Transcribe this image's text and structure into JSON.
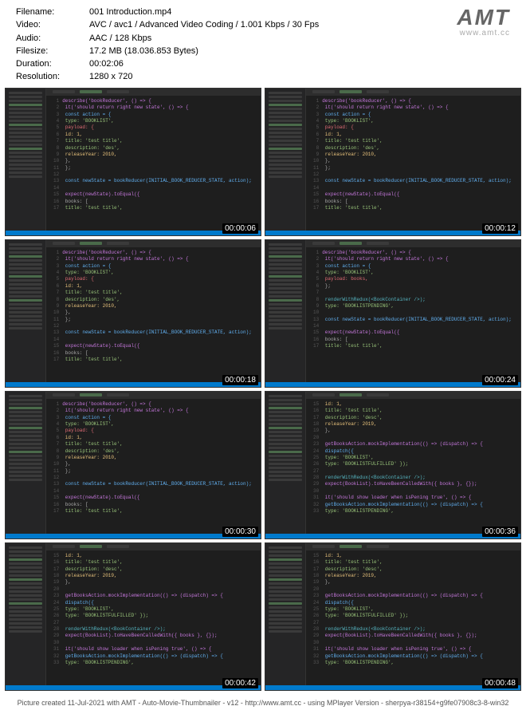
{
  "meta": {
    "labels": {
      "filename": "Filename:",
      "video": "Video:",
      "audio": "Audio:",
      "filesize": "Filesize:",
      "duration": "Duration:",
      "resolution": "Resolution:"
    },
    "values": {
      "filename": "001 Introduction.mp4",
      "video": "AVC / avc1 / Advanced Video Coding / 1.001 Kbps / 30 Fps",
      "audio": "AAC / 128 Kbps",
      "filesize": "17.2 MB (18.036.853 Bytes)",
      "duration": "00:02:06",
      "resolution": "1280 x 720"
    }
  },
  "logo": {
    "big": "AMT",
    "small": "www.amt.cc"
  },
  "thumbnails": [
    {
      "timestamp": "00:00:06",
      "variant": "a"
    },
    {
      "timestamp": "00:00:12",
      "variant": "a"
    },
    {
      "timestamp": "00:00:18",
      "variant": "a"
    },
    {
      "timestamp": "00:00:24",
      "variant": "b"
    },
    {
      "timestamp": "00:00:30",
      "variant": "a"
    },
    {
      "timestamp": "00:00:36",
      "variant": "c"
    },
    {
      "timestamp": "00:00:42",
      "variant": "c"
    },
    {
      "timestamp": "00:00:48",
      "variant": "c"
    }
  ],
  "code_variant_a": [
    {
      "n": "1",
      "t": "describe('bookReducer', () => {",
      "c": "pur"
    },
    {
      "n": "2",
      "t": "  it('should return right new state', () => {",
      "c": "pur"
    },
    {
      "n": "3",
      "t": "    const action = {",
      "c": "blu"
    },
    {
      "n": "4",
      "t": "      type: 'BOOKLIST',",
      "c": "grn"
    },
    {
      "n": "5",
      "t": "      payload: {",
      "c": "red"
    },
    {
      "n": "6",
      "t": "        id: 1,",
      "c": "yel"
    },
    {
      "n": "7",
      "t": "        title: 'test title',",
      "c": "grn"
    },
    {
      "n": "8",
      "t": "        description: 'des',",
      "c": "grn"
    },
    {
      "n": "9",
      "t": "        releaseYear: 2010,",
      "c": "yel"
    },
    {
      "n": "10",
      "t": "      },",
      "c": ""
    },
    {
      "n": "11",
      "t": "    };",
      "c": ""
    },
    {
      "n": "12",
      "t": "",
      "c": ""
    },
    {
      "n": "13",
      "t": "    const newState = bookReducer(INITIAL_BOOK_REDUCER_STATE, action);",
      "c": "blu"
    },
    {
      "n": "14",
      "t": "",
      "c": ""
    },
    {
      "n": "15",
      "t": "    expect(newState).toEqual({",
      "c": "pur"
    },
    {
      "n": "16",
      "t": "      books: [",
      "c": ""
    },
    {
      "n": "17",
      "t": "        title: 'test title',",
      "c": "grn"
    }
  ],
  "code_variant_b": [
    {
      "n": "1",
      "t": "describe('bookReducer', () => {",
      "c": "pur"
    },
    {
      "n": "2",
      "t": "  it('should return right new state', () => {",
      "c": "pur"
    },
    {
      "n": "3",
      "t": "    const action = {",
      "c": "blu"
    },
    {
      "n": "4",
      "t": "      type: 'BOOKLIST',",
      "c": "grn"
    },
    {
      "n": "5",
      "t": "      payload: books,",
      "c": "red"
    },
    {
      "n": "6",
      "t": "    };",
      "c": ""
    },
    {
      "n": "7",
      "t": "",
      "c": ""
    },
    {
      "n": "8",
      "t": "    renderWithRedux(<BookContainer />);",
      "c": "cyn"
    },
    {
      "n": "9",
      "t": "      type: 'BOOKLISTPENDING',",
      "c": "grn"
    },
    {
      "n": "10",
      "t": "",
      "c": ""
    },
    {
      "n": "13",
      "t": "    const newState = bookReducer(INITIAL_BOOK_REDUCER_STATE, action);",
      "c": "blu"
    },
    {
      "n": "14",
      "t": "",
      "c": ""
    },
    {
      "n": "15",
      "t": "    expect(newState).toEqual({",
      "c": "pur"
    },
    {
      "n": "16",
      "t": "      books: [",
      "c": ""
    },
    {
      "n": "17",
      "t": "        title: 'test title',",
      "c": "grn"
    }
  ],
  "code_variant_c": [
    {
      "n": "15",
      "t": "      id: 1,",
      "c": "yel"
    },
    {
      "n": "16",
      "t": "      title: 'test title',",
      "c": "grn"
    },
    {
      "n": "17",
      "t": "      description: 'desc',",
      "c": "grn"
    },
    {
      "n": "18",
      "t": "      releaseYear: 2019,",
      "c": "yel"
    },
    {
      "n": "19",
      "t": "    },",
      "c": ""
    },
    {
      "n": "20",
      "t": "",
      "c": ""
    },
    {
      "n": "23",
      "t": "  getBooksAction.mockImplementation(() => (dispatch) => {",
      "c": "pur"
    },
    {
      "n": "24",
      "t": "    dispatch({",
      "c": "blu"
    },
    {
      "n": "25",
      "t": "      type: 'BOOKLIST',",
      "c": "grn"
    },
    {
      "n": "26",
      "t": "      type: 'BOOKLISTFULFILLED' });",
      "c": "grn"
    },
    {
      "n": "27",
      "t": "",
      "c": ""
    },
    {
      "n": "28",
      "t": "    renderWithRedux(<BookContainer />);",
      "c": "cyn"
    },
    {
      "n": "29",
      "t": "    expect(BookList).toHaveBeenCalledWith({ books }, {});",
      "c": "pur"
    },
    {
      "n": "30",
      "t": "",
      "c": ""
    },
    {
      "n": "31",
      "t": "  it('should show loader when isPening true', () => {",
      "c": "pur"
    },
    {
      "n": "32",
      "t": "    getBooksAction.mockImplementation(() => (dispatch) => {",
      "c": "blu"
    },
    {
      "n": "33",
      "t": "      type: 'BOOKLISTPENDING',",
      "c": "grn"
    }
  ],
  "footer": "Picture created 11-Jul-2021 with AMT - Auto-Movie-Thumbnailer - v12 - http://www.amt.cc - using MPlayer Version - sherpya-r38154+g9fe07908c3-8-win32"
}
